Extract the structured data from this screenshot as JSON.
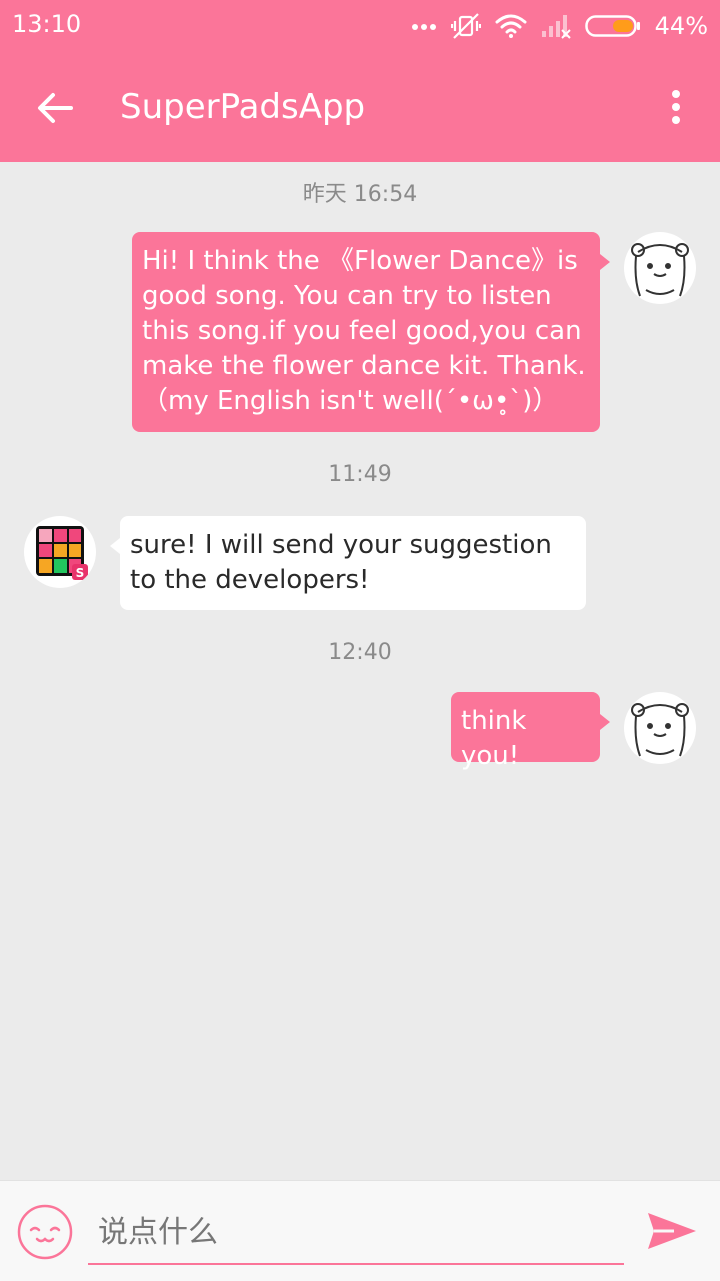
{
  "status_bar": {
    "time": "13:10",
    "battery_percent": "44%",
    "icons": [
      "more-dots-icon",
      "vibrate-off-icon",
      "wifi-icon",
      "signal-icon",
      "battery-icon"
    ]
  },
  "app_bar": {
    "title": "SuperPadsApp",
    "back_icon": "arrow-back-icon",
    "menu_icon": "more-vert-icon",
    "color": "#fb7599"
  },
  "chat": {
    "timestamps": [
      "昨天 16:54",
      "11:49",
      "12:40"
    ],
    "messages": [
      {
        "direction": "outgoing",
        "lines": [
          "Hi! I think the 《Flower Dance》is",
          "good song. You can try to listen",
          "this song.if you feel good,you can",
          "make the flower dance kit. Thank.",
          "（my English isn't well(´•ω•̥`)）"
        ],
        "avatar": "bear-avatar-icon"
      },
      {
        "direction": "incoming",
        "lines": [
          "sure! I will send your suggestion",
          "to the developers!"
        ],
        "avatar": "superpads-logo-avatar"
      },
      {
        "direction": "outgoing",
        "lines": [
          "think you!"
        ],
        "avatar": "bear-avatar-icon"
      }
    ]
  },
  "composer": {
    "placeholder": "说点什么",
    "emoji_icon": "smiley-face-icon",
    "send_icon": "send-icon",
    "accent": "#fb7599"
  }
}
